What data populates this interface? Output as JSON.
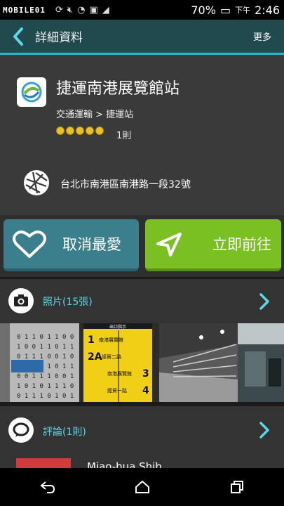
{
  "status_bar": {
    "logo": "MOBILE01",
    "battery_percent": "70%",
    "time_prefix": "下午",
    "time": "2:46"
  },
  "header": {
    "title": "詳細資料",
    "more": "更多"
  },
  "place": {
    "name": "捷運南港展覽館站",
    "category": "交通運輸 > 捷運站",
    "rating": 5,
    "review_count": "1則",
    "address": "台北市南港區南港路一段32號"
  },
  "actions": {
    "favorite_label": "取消最愛",
    "go_label": "立即前往",
    "favorite_color": "#3b7f8c",
    "go_color": "#7ac023"
  },
  "photos_section": {
    "label": "照片(15張)"
  },
  "sign_photo": {
    "title": "出口指示",
    "rows": [
      {
        "num": "1",
        "text": "南港展覽館"
      },
      {
        "num": "2A",
        "text": "經貿二路"
      },
      {
        "num": "3",
        "text": "南港展覽館"
      },
      {
        "num": "4",
        "text": "經貿一路"
      }
    ]
  },
  "reviews_section": {
    "label": "評論(1則)",
    "reviewer": "Miao-hua Shih"
  }
}
